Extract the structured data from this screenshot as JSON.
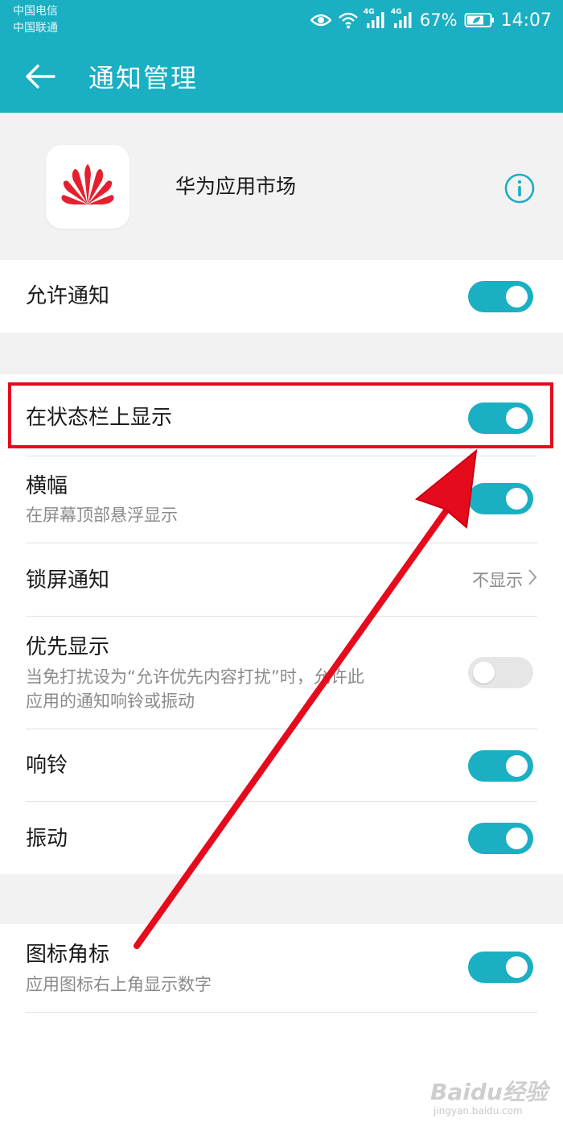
{
  "status_bar": {
    "carrier_1": "中国电信",
    "carrier_2": "中国联通",
    "signal_1_type": "4G",
    "signal_2_type": "4G",
    "battery": "67%",
    "time": "14:07",
    "icons": [
      "eye-icon",
      "wifi-icon",
      "signal-icon",
      "signal-icon",
      "battery-icon"
    ]
  },
  "header": {
    "back_icon": "arrow-left-icon",
    "title": "通知管理"
  },
  "app": {
    "name": "华为应用市场",
    "logo_icon": "huawei-logo-icon",
    "info_icon": "info-circle-icon"
  },
  "settings": {
    "allow_notifications": {
      "title": "允许通知",
      "enabled": true
    },
    "show_on_status_bar": {
      "title": "在状态栏上显示",
      "enabled": true
    },
    "banner": {
      "title": "横幅",
      "subtitle": "在屏幕顶部悬浮显示",
      "enabled": true
    },
    "lock_screen": {
      "title": "锁屏通知",
      "value": "不显示"
    },
    "priority": {
      "title": "优先显示",
      "subtitle_line1": "当免打扰设为“允许优先内容打扰”时，允许此",
      "subtitle_line2": "应用的通知响铃或振动",
      "enabled": false
    },
    "ringtone": {
      "title": "响铃",
      "enabled": true
    },
    "vibration": {
      "title": "振动",
      "enabled": true
    },
    "badge": {
      "title": "图标角标",
      "subtitle": "应用图标右上角显示数字",
      "enabled": true
    }
  },
  "watermark": {
    "brand": "Baidu经验",
    "site": "jingyan.baidu.com"
  },
  "colors": {
    "accent": "#1aafc2",
    "annotation": "#e60a1d",
    "background_gray": "#f2f2f2"
  }
}
